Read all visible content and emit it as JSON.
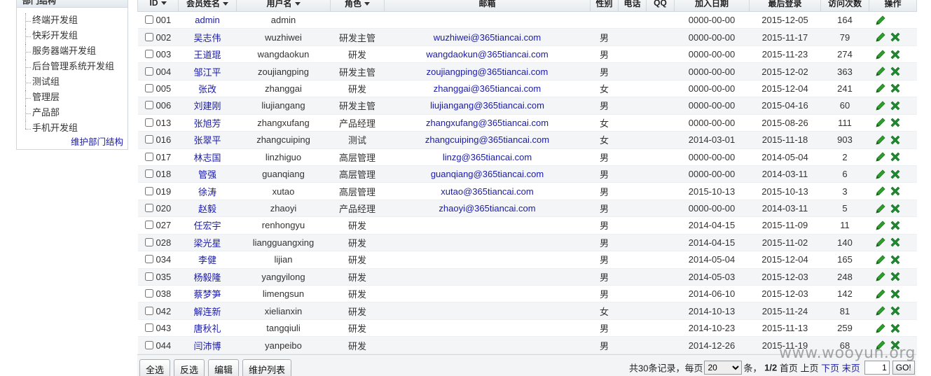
{
  "left_panel": {
    "title": "部门结构",
    "departments": [
      "终端开发组",
      "快彩开发组",
      "服务器端开发组",
      "后台管理系统开发组",
      "测试组",
      "管理层",
      "产品部",
      "手机开发组"
    ],
    "maintain_link": "维护部门结构"
  },
  "table": {
    "headers": [
      "ID",
      "会员姓名",
      "用户名",
      "角色",
      "邮箱",
      "性别",
      "电话",
      "QQ",
      "加入日期",
      "最后登录",
      "访问次数",
      "操作"
    ],
    "rows": [
      {
        "id": "001",
        "name": "admin",
        "username": "admin",
        "role": "",
        "email": "",
        "gender": "",
        "join": "0000-00-00",
        "last": "2015-12-05",
        "visits": "164",
        "deletable": false
      },
      {
        "id": "002",
        "name": "吴志伟",
        "username": "wuzhiwei",
        "role": "研发主管",
        "email": "wuzhiwei@365tiancai.com",
        "gender": "男",
        "join": "0000-00-00",
        "last": "2015-11-17",
        "visits": "79",
        "deletable": true
      },
      {
        "id": "003",
        "name": "王道琨",
        "username": "wangdaokun",
        "role": "研发",
        "email": "wangdaokun@365tiancai.com",
        "gender": "男",
        "join": "0000-00-00",
        "last": "2015-11-23",
        "visits": "274",
        "deletable": true
      },
      {
        "id": "004",
        "name": "邹江平",
        "username": "zoujiangping",
        "role": "研发主管",
        "email": "zoujiangping@365tiancai.com",
        "gender": "男",
        "join": "0000-00-00",
        "last": "2015-12-02",
        "visits": "363",
        "deletable": true
      },
      {
        "id": "005",
        "name": "张改",
        "username": "zhanggai",
        "role": "研发",
        "email": "zhanggai@365tiancai.com",
        "gender": "女",
        "join": "0000-00-00",
        "last": "2015-12-04",
        "visits": "241",
        "deletable": true
      },
      {
        "id": "006",
        "name": "刘建刚",
        "username": "liujiangang",
        "role": "研发主管",
        "email": "liujiangang@365tiancai.com",
        "gender": "男",
        "join": "0000-00-00",
        "last": "2015-04-16",
        "visits": "60",
        "deletable": true
      },
      {
        "id": "013",
        "name": "张旭芳",
        "username": "zhangxufang",
        "role": "产品经理",
        "email": "zhangxufang@365tiancai.com",
        "gender": "女",
        "join": "0000-00-00",
        "last": "2015-08-26",
        "visits": "111",
        "deletable": true
      },
      {
        "id": "016",
        "name": "张翠平",
        "username": "zhangcuiping",
        "role": "测试",
        "email": "zhangcuiping@365tiancai.com",
        "gender": "女",
        "join": "2014-03-01",
        "last": "2015-11-18",
        "visits": "903",
        "deletable": true
      },
      {
        "id": "017",
        "name": "林志国",
        "username": "linzhiguo",
        "role": "高层管理",
        "email": "linzg@365tiancai.com",
        "gender": "男",
        "join": "0000-00-00",
        "last": "2014-05-04",
        "visits": "2",
        "deletable": true
      },
      {
        "id": "018",
        "name": "管强",
        "username": "guanqiang",
        "role": "高层管理",
        "email": "guanqiang@365tiancai.com",
        "gender": "男",
        "join": "0000-00-00",
        "last": "2014-03-11",
        "visits": "6",
        "deletable": true
      },
      {
        "id": "019",
        "name": "徐涛",
        "username": "xutao",
        "role": "高层管理",
        "email": "xutao@365tiancai.com",
        "gender": "男",
        "join": "2015-10-13",
        "last": "2015-10-13",
        "visits": "3",
        "deletable": true
      },
      {
        "id": "020",
        "name": "赵毅",
        "username": "zhaoyi",
        "role": "产品经理",
        "email": "zhaoyi@365tiancai.com",
        "gender": "男",
        "join": "0000-00-00",
        "last": "2014-03-11",
        "visits": "5",
        "deletable": true
      },
      {
        "id": "027",
        "name": "任宏宇",
        "username": "renhongyu",
        "role": "研发",
        "email": "",
        "gender": "男",
        "join": "2014-04-15",
        "last": "2015-11-09",
        "visits": "11",
        "deletable": true
      },
      {
        "id": "028",
        "name": "梁光星",
        "username": "liangguangxing",
        "role": "研发",
        "email": "",
        "gender": "男",
        "join": "2014-04-15",
        "last": "2015-11-02",
        "visits": "140",
        "deletable": true
      },
      {
        "id": "034",
        "name": "李健",
        "username": "lijian",
        "role": "研发",
        "email": "",
        "gender": "男",
        "join": "2014-05-04",
        "last": "2015-12-04",
        "visits": "165",
        "deletable": true
      },
      {
        "id": "035",
        "name": "杨毅隆",
        "username": "yangyilong",
        "role": "研发",
        "email": "",
        "gender": "男",
        "join": "2014-05-03",
        "last": "2015-12-03",
        "visits": "248",
        "deletable": true
      },
      {
        "id": "038",
        "name": "蔡梦笋",
        "username": "limengsun",
        "role": "研发",
        "email": "",
        "gender": "男",
        "join": "2014-06-10",
        "last": "2015-12-03",
        "visits": "142",
        "deletable": true
      },
      {
        "id": "042",
        "name": "解连新",
        "username": "xielianxin",
        "role": "研发",
        "email": "",
        "gender": "女",
        "join": "2014-10-13",
        "last": "2015-11-24",
        "visits": "81",
        "deletable": true
      },
      {
        "id": "043",
        "name": "唐秋礼",
        "username": "tangqiuli",
        "role": "研发",
        "email": "",
        "gender": "男",
        "join": "2014-10-23",
        "last": "2015-11-13",
        "visits": "259",
        "deletable": true
      },
      {
        "id": "044",
        "name": "闫沛博",
        "username": "yanpeibo",
        "role": "研发",
        "email": "",
        "gender": "男",
        "join": "2014-12-26",
        "last": "2015-11-19",
        "visits": "68",
        "deletable": true
      }
    ]
  },
  "toolbar": {
    "select_all": "全选",
    "invert": "反选",
    "edit": "编辑",
    "maintain_list": "维护列表"
  },
  "pager": {
    "total_text": "共30条记录，每页",
    "page_size": "20",
    "page_size_options": [
      "20"
    ],
    "unit": "条，",
    "page_info": "1/2",
    "first": "首页",
    "prev": "上页",
    "next": "下页",
    "last": "末页",
    "page_input": "1",
    "go": "GO!"
  },
  "watermark": "www.wooyun.org",
  "colors": {
    "link": "#1a1aa8",
    "edit_icon": "#2e9e2e",
    "delete_icon": "#1e8a2e"
  }
}
